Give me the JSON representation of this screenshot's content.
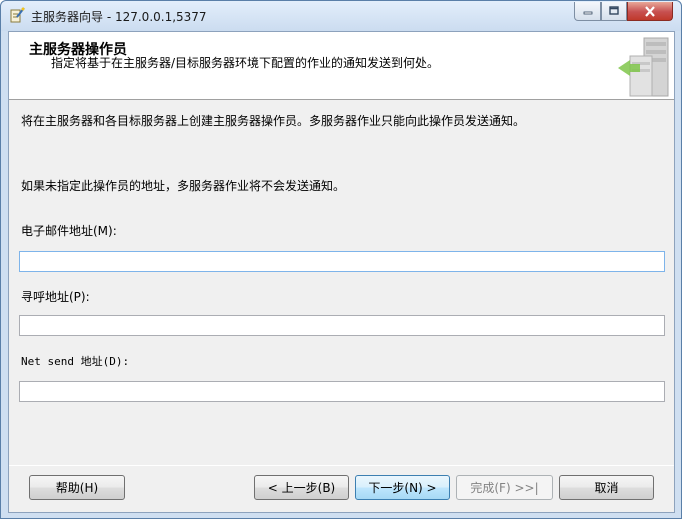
{
  "window": {
    "title": "主服务器向导 - 127.0.0.1,5377"
  },
  "header": {
    "title": "主服务器操作员",
    "subtitle": "指定将基于在主服务器/目标服务器环境下配置的作业的通知发送到何处。"
  },
  "body": {
    "line1": "将在主服务器和各目标服务器上创建主服务器操作员。多服务器作业只能向此操作员发送通知。",
    "line2": "如果未指定此操作员的地址，多服务器作业将不会发送通知。"
  },
  "fields": {
    "email_label": "电子邮件地址(M):",
    "email_value": "",
    "pager_label": "寻呼地址(P):",
    "pager_value": "",
    "netsend_label": "Net send 地址(D):",
    "netsend_value": ""
  },
  "buttons": {
    "help": "帮助(H)",
    "back": "< 上一步(B)",
    "next": "下一步(N) >",
    "finish": "完成(F) >>|",
    "cancel": "取消"
  },
  "icons": {
    "app": "wizard-icon",
    "minimize": "minimize-icon",
    "maximize": "maximize-icon",
    "close": "close-icon",
    "header_graphic": "server-icon"
  },
  "colors": {
    "accent": "#3c7fb1",
    "close_button": "#c75050"
  }
}
